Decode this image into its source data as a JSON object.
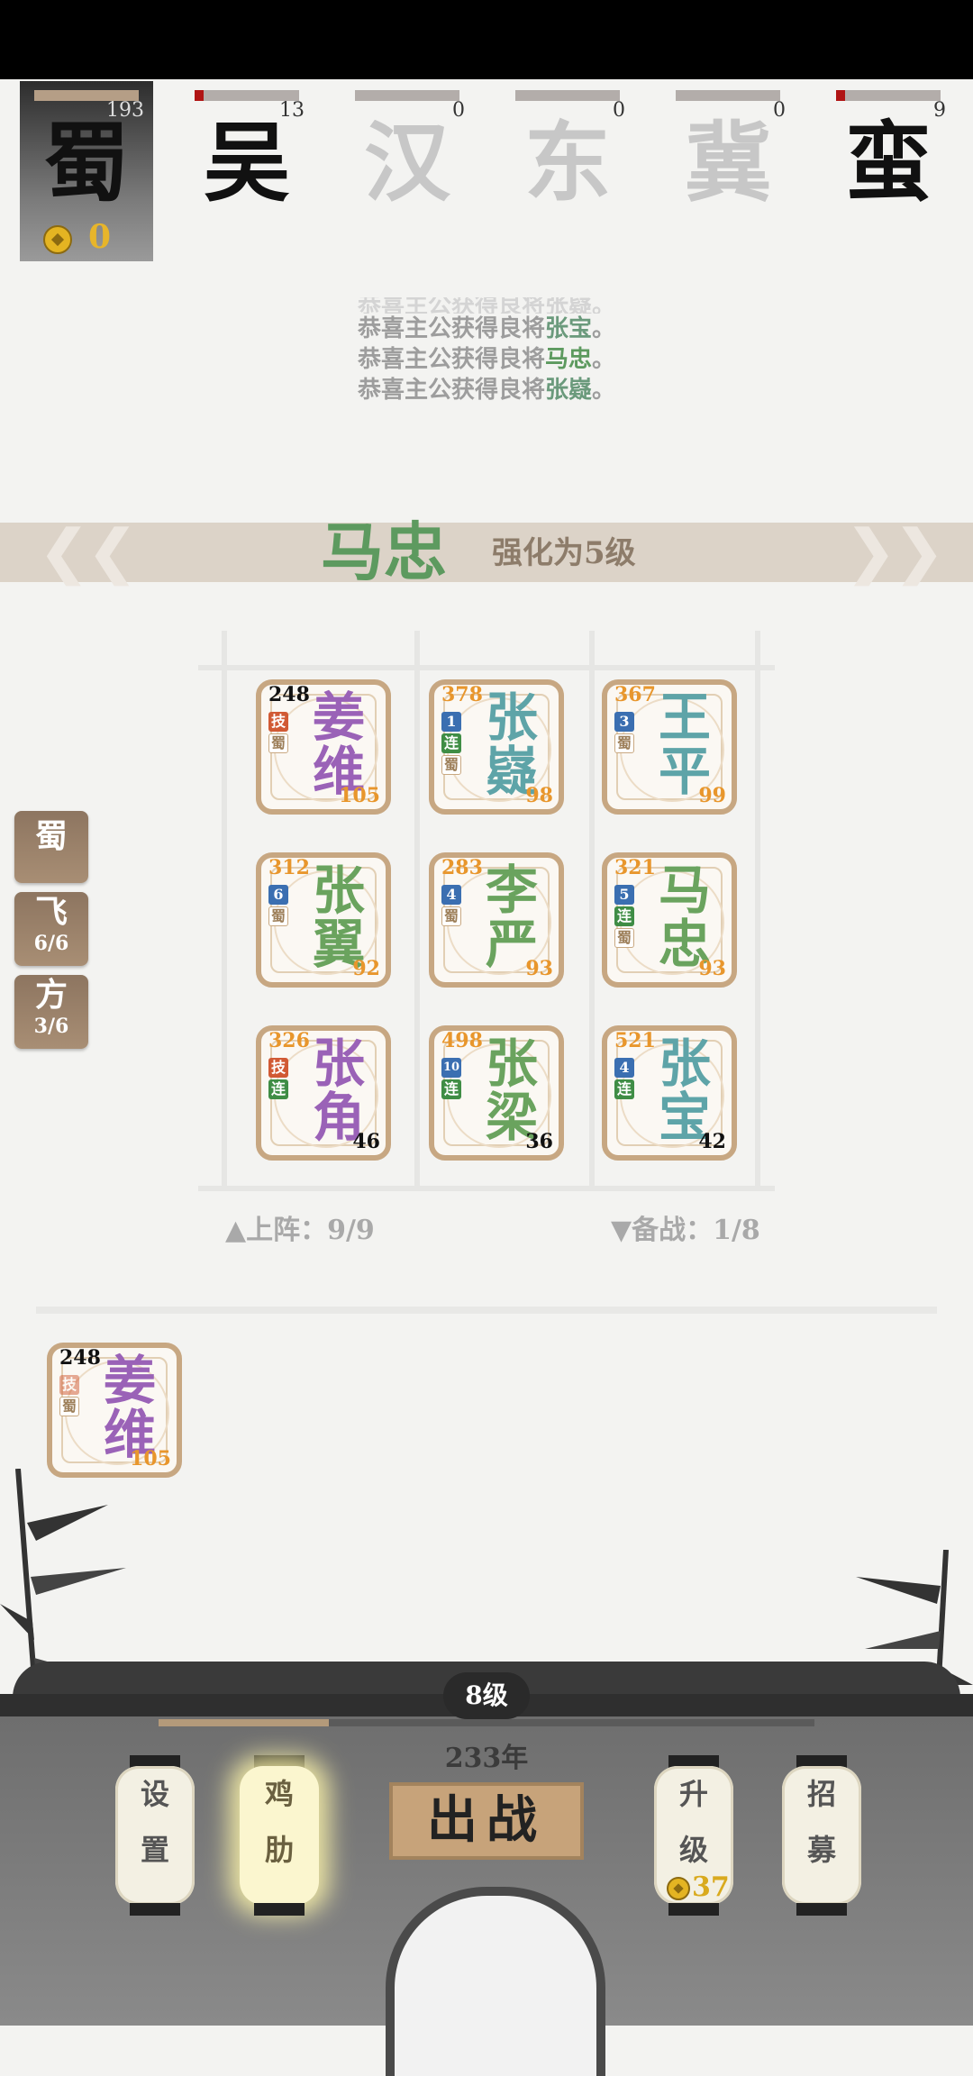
{
  "factions": [
    {
      "name": "蜀",
      "count": "193",
      "gold": "0",
      "selected": true
    },
    {
      "name": "吴",
      "count": "13"
    },
    {
      "name": "汉",
      "count": "0"
    },
    {
      "name": "东",
      "count": "0"
    },
    {
      "name": "冀",
      "count": "0"
    },
    {
      "name": "蛮",
      "count": "9"
    }
  ],
  "log": {
    "line0": "恭喜主公获得良将张嶷。",
    "line1_prefix": "恭喜主公获得良将",
    "line1_name": "张宝",
    "line1_end": "。",
    "line2_prefix": "恭喜主公获得良将",
    "line2_name": "马忠",
    "line2_end": "。",
    "line3_prefix": "恭喜主公获得良将",
    "line3_name": "张嶷",
    "line3_end": "。"
  },
  "banner": {
    "name": "马忠",
    "desc": "强化为5级"
  },
  "board_cards": [
    {
      "atk": "248",
      "tags": [
        "技",
        "蜀"
      ],
      "name1": "姜",
      "name2": "维",
      "lv": "105"
    },
    {
      "atk": "378",
      "tags": [
        "1",
        "连",
        "蜀"
      ],
      "name1": "张",
      "name2": "嶷",
      "lv": "98"
    },
    {
      "atk": "367",
      "tags": [
        "3",
        "蜀"
      ],
      "name1": "王",
      "name2": "平",
      "lv": "99"
    },
    {
      "atk": "312",
      "tags": [
        "6",
        "蜀"
      ],
      "name1": "张",
      "name2": "翼",
      "lv": "92"
    },
    {
      "atk": "283",
      "tags": [
        "4",
        "蜀"
      ],
      "name1": "李",
      "name2": "严",
      "lv": "93"
    },
    {
      "atk": "321",
      "tags": [
        "5",
        "连",
        "蜀"
      ],
      "name1": "马",
      "name2": "忠",
      "lv": "93"
    },
    {
      "atk": "326",
      "tags": [
        "技",
        "连"
      ],
      "name1": "张",
      "name2": "角",
      "lv": "46"
    },
    {
      "atk": "498",
      "tags": [
        "10",
        "连"
      ],
      "name1": "张",
      "name2": "梁",
      "lv": "36"
    },
    {
      "atk": "521",
      "tags": [
        "4",
        "连"
      ],
      "name1": "张",
      "name2": "宝",
      "lv": "42"
    }
  ],
  "reserve_card": {
    "atk": "248",
    "tags": [
      "技",
      "蜀"
    ],
    "name1": "姜",
    "name2": "维",
    "lv": "105"
  },
  "side_buttons": [
    {
      "big": "蜀",
      "small": ""
    },
    {
      "big": "飞",
      "small": "6/6"
    },
    {
      "big": "方",
      "small": "3/6"
    }
  ],
  "stats": {
    "deployed": "▲上阵：9/9",
    "reserve": "▼备战：1/8"
  },
  "base": {
    "level": "8级",
    "year": "233年",
    "xp_fraction": 0.26,
    "settings": [
      "设",
      "置"
    ],
    "rooster": [
      "鸡",
      "肋"
    ],
    "fight": "出战",
    "upgrade": [
      "升",
      "级"
    ],
    "upgrade_cost": "37",
    "recruit": [
      "招",
      "募"
    ]
  },
  "colors": {
    "shu": "#9a62b7",
    "teal": "#5ea4a8",
    "green": "#6aa35e",
    "accent": "#c7a782"
  }
}
